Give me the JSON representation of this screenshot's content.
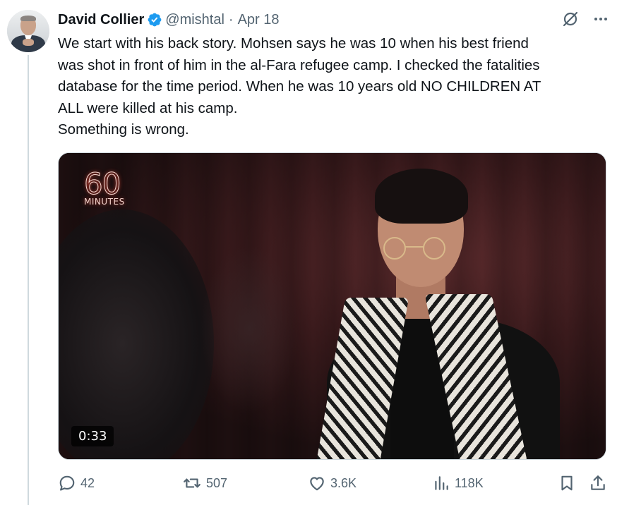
{
  "tweet": {
    "display_name": "David Collier",
    "handle": "@mishtal",
    "separator": "·",
    "date": "Apr 18",
    "text_lines": [
      "We start with his back story. Mohsen says he was 10 when his best friend",
      "was shot in front of him in the al-Fara refugee camp. I checked the fatalities",
      "database for the time period. When he was 10 years old NO CHILDREN AT",
      "ALL were killed at his camp.",
      "Something is wrong."
    ]
  },
  "media": {
    "logo_number": "60",
    "logo_word": "MINUTES",
    "duration": "0:33"
  },
  "actions": {
    "replies": "42",
    "retweets": "507",
    "likes": "3.6K",
    "views": "118K"
  },
  "icons": {
    "verified": "verified-badge-icon",
    "grok": "grok-icon",
    "more": "more-options-icon",
    "reply": "reply-icon",
    "retweet": "retweet-icon",
    "like": "like-icon",
    "views": "views-icon",
    "bookmark": "bookmark-icon",
    "share": "share-icon"
  },
  "colors": {
    "verified_blue": "#1d9bf0",
    "muted_text": "#536471",
    "primary_text": "#0f1419"
  }
}
